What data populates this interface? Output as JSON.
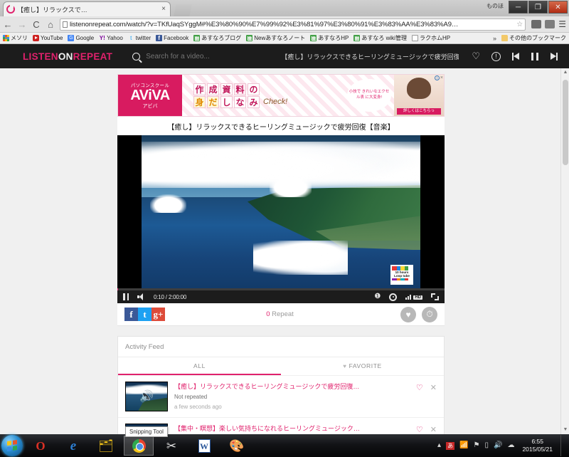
{
  "browser": {
    "tab": {
      "title": "【癒し】リラックスで…",
      "favicon_name": "listenonrepeat-favicon",
      "close_label": "×"
    },
    "window_controls": {
      "restore_hint": "ものほ",
      "minimize": "─",
      "maximize": "❐",
      "close": "✕"
    },
    "toolbar": {
      "back": "←",
      "forward": "→",
      "reload": "C",
      "home": "⌂",
      "url": "listenonrepeat.com/watch/?v=TKfUaqSYggM#%E3%80%90%E7%99%92%E3%81%97%E3%80%91%E3%83%AA%E3%83%A9…",
      "star": "☆",
      "menu": "☰"
    },
    "bookmarks": [
      {
        "label": "メソリ",
        "icon": "apps-grid-icon"
      },
      {
        "label": "YouTube",
        "icon": "youtube-icon"
      },
      {
        "label": "Google",
        "icon": "google-icon"
      },
      {
        "label": "Yahoo",
        "icon": "yahoo-icon"
      },
      {
        "label": "twitter",
        "icon": "twitter-icon"
      },
      {
        "label": "Facebook",
        "icon": "facebook-icon"
      },
      {
        "label": "あすなろブログ",
        "icon": "qr-green-icon"
      },
      {
        "label": "Newあすなろノート",
        "icon": "qr-green-icon"
      },
      {
        "label": "あすなろHP",
        "icon": "qr-green-icon"
      },
      {
        "label": "あすなろ wiki管理",
        "icon": "qr-green-icon"
      },
      {
        "label": "ラクホムHP",
        "icon": "document-icon"
      }
    ],
    "bookmarks_overflow": "»",
    "bookmarks_other": {
      "label": "その他のブックマーク",
      "icon": "folder-icon"
    }
  },
  "site": {
    "logo": {
      "listen": "LISTEN",
      "on": "ON",
      "repeat": "REPEAT"
    },
    "search": {
      "placeholder": "Search for a video...",
      "value": "",
      "icon": "search-icon"
    },
    "now_playing": "【癒し】リラックスできるヒーリングミュージックで疲労回復【音楽】",
    "header_controls": {
      "favorite": "♡",
      "info": "!",
      "previous": "prev-track-icon",
      "pause": "pause-icon",
      "next": "next-track-icon"
    }
  },
  "ad": {
    "brand_top": "パソコンスクール",
    "brand_logo": "AViVA",
    "brand_sub": "アビバ",
    "line1": [
      "作",
      "成",
      "資",
      "料",
      "の"
    ],
    "line2": [
      "身",
      "だ",
      "し",
      "な",
      "み"
    ],
    "check": "Check!",
    "bubble": "小技で きれいなエクセル表 に大変身!",
    "cta": "詳しくはこちらっ",
    "info_icon": "ad-info-icon",
    "close_icon": "×"
  },
  "video": {
    "title": "【癒し】リラックスできるヒーリングミュージックで疲労回復【音楽】",
    "watermark": "10 hours Loop tube",
    "controls": {
      "pause": "pause-icon",
      "volume": "volume-icon",
      "time_current": "0:10",
      "time_separator": "/",
      "time_total": "2:00:00",
      "time_display": "0:10 / 2:00:00",
      "annotations": "!",
      "settings": "gear-icon",
      "quality_badge": "HD",
      "fullscreen": "fullscreen-icon"
    },
    "progress_percent": 0.14
  },
  "social": {
    "facebook": "f",
    "twitter": "t",
    "googleplus": "g+",
    "repeat_count": "0",
    "repeat_label": "Repeat",
    "favorite_btn": "♥",
    "timer_btn": "⏱"
  },
  "feed": {
    "title": "Activity Feed",
    "tabs": [
      {
        "label": "ALL",
        "active": true,
        "icon": ""
      },
      {
        "label": "FAVORITE",
        "active": false,
        "icon": "♥"
      }
    ],
    "items": [
      {
        "title": "【癒し】リラックスできるヒーリングミュージックで疲労回復…",
        "status": "Not repeated",
        "time": "a few seconds ago",
        "favorite_icon": "♡",
        "remove_icon": "✕",
        "thumb_icon": "speaker-icon"
      },
      {
        "title": "【集中・瞑想】楽しい気持ちになれるヒーリングミュージック…",
        "status": "",
        "time": "",
        "favorite_icon": "♡",
        "remove_icon": "✕",
        "thumb_icon": "speaker-icon"
      }
    ]
  },
  "tooltip": {
    "snipping_tool": "Snipping Tool"
  },
  "taskbar": {
    "start": "start-orb",
    "items": [
      {
        "name": "opera-icon",
        "glyph": "O"
      },
      {
        "name": "internet-explorer-icon",
        "glyph": "e"
      },
      {
        "name": "file-explorer-icon",
        "glyph": "🗂"
      },
      {
        "name": "google-chrome-icon",
        "glyph": "",
        "active": true
      },
      {
        "name": "snipping-tool-icon",
        "glyph": "✂"
      },
      {
        "name": "microsoft-word-icon",
        "glyph": "W"
      },
      {
        "name": "paint-icon",
        "glyph": "🎨"
      }
    ],
    "tray": {
      "overflow": "▴",
      "ime": "あ",
      "network": "📶",
      "flag": "⚑",
      "battery": "▯",
      "volume": "🔊",
      "cloud": "☁",
      "time": "6:55",
      "date": "2015/05/21"
    }
  },
  "colors": {
    "brand_pink": "#e0216c",
    "header_dark": "#1c1c1c",
    "page_bg": "#f0f0f0"
  }
}
